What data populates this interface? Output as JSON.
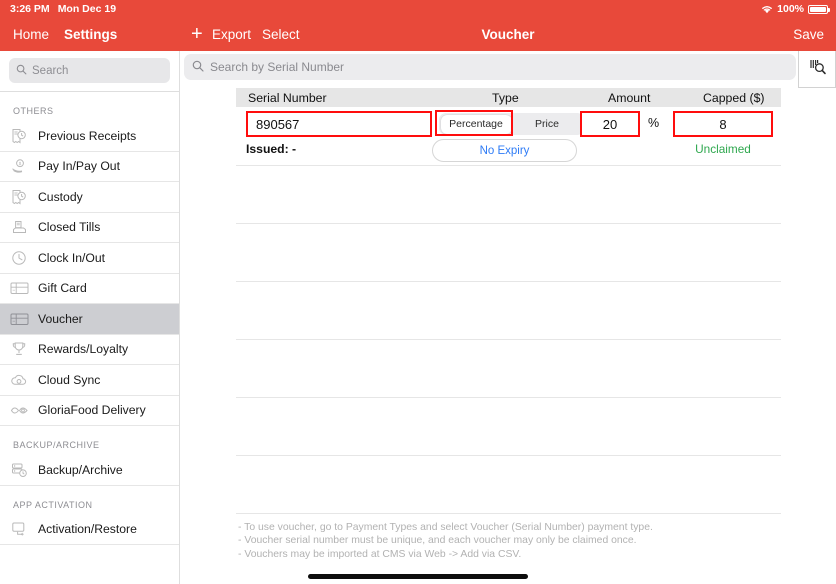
{
  "statusbar": {
    "time": "3:26 PM",
    "date": "Mon Dec 19",
    "battery_percent": "100%",
    "wifi_icon": "wifi-icon",
    "battery_icon": "battery-full-icon"
  },
  "navbar": {
    "home_label": "Home",
    "settings_label": "Settings",
    "add_icon": "plus-icon",
    "export_label": "Export",
    "select_label": "Select",
    "title": "Voucher",
    "save_label": "Save"
  },
  "sidebar": {
    "search_placeholder": "Search",
    "search_icon": "search-icon",
    "groups": [
      {
        "header": "OTHERS",
        "items": [
          {
            "label": "Previous Receipts",
            "icon": "receipt-icon",
            "selected": false
          },
          {
            "label": "Pay In/Pay Out",
            "icon": "cash-hand-icon",
            "selected": false
          },
          {
            "label": "Custody",
            "icon": "receipt-icon",
            "selected": false
          },
          {
            "label": "Closed Tills",
            "icon": "register-icon",
            "selected": false
          },
          {
            "label": "Clock In/Out",
            "icon": "clock-icon",
            "selected": false
          },
          {
            "label": "Gift Card",
            "icon": "card-icon",
            "selected": false
          },
          {
            "label": "Voucher",
            "icon": "card-icon",
            "selected": true
          },
          {
            "label": "Rewards/Loyalty",
            "icon": "trophy-icon",
            "selected": false
          },
          {
            "label": "Cloud Sync",
            "icon": "cloud-icon",
            "selected": false
          },
          {
            "label": "GloriaFood Delivery",
            "icon": "leaf-icon",
            "selected": false
          }
        ]
      },
      {
        "header": "BACKUP/ARCHIVE",
        "items": [
          {
            "label": "Backup/Archive",
            "icon": "database-clock-icon",
            "selected": false
          }
        ]
      },
      {
        "header": "APP ACTIVATION",
        "items": [
          {
            "label": "Activation/Restore",
            "icon": "device-restore-icon",
            "selected": false
          }
        ]
      }
    ]
  },
  "main": {
    "search_placeholder": "Search by Serial Number",
    "search_icon": "search-icon",
    "scan_button_icon": "barcode-scan-icon",
    "table": {
      "headers": {
        "serial": "Serial Number",
        "type": "Type",
        "amount": "Amount",
        "capped": "Capped ($)"
      },
      "row": {
        "serial_number": "890567",
        "type_options": [
          "Percentage",
          "Price"
        ],
        "type_selected": "Percentage",
        "amount": "20",
        "amount_unit": "%",
        "capped": "8",
        "issued_label": "Issued: -",
        "expiry_label": "No Expiry",
        "claim_status": "Unclaimed"
      },
      "empty_row_count": 6
    },
    "notes": [
      "- To use voucher, go to Payment Types and select Voucher (Serial Number) payment type.",
      "- Voucher serial number must be unique, and each voucher may only be claimed once.",
      "- Vouchers may be imported at CMS via Web -> Add via CSV."
    ]
  },
  "colors": {
    "accent_red": "#e8493a",
    "highlight_red": "#ff0d0d",
    "link_blue": "#2f7cf6",
    "status_green": "#2fa84f"
  }
}
